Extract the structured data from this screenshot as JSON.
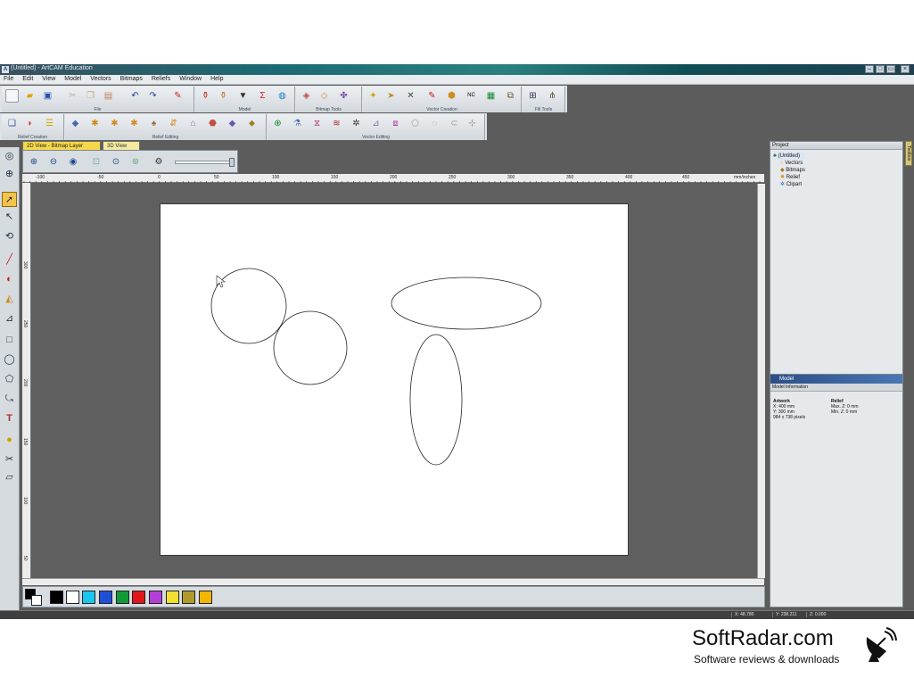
{
  "window": {
    "title": "(Untitled) - ArtCAM Education",
    "app_icon": "A"
  },
  "menu": [
    "File",
    "Edit",
    "View",
    "Model",
    "Vectors",
    "Bitmaps",
    "Reliefs",
    "Window",
    "Help"
  ],
  "toolbar_groups_row1": [
    "File",
    "Model",
    "Bitmap Tools",
    "Vector Creation",
    "Fill Tools"
  ],
  "toolbar_groups_row2": [
    "Relief Creation",
    "Relief Editing",
    "Vector Editing"
  ],
  "view_tabs": [
    {
      "label": "2D View - Bitmap Layer",
      "active": true
    },
    {
      "label": "3D View",
      "active": false
    }
  ],
  "ruler": {
    "h_labels": [
      "-100",
      "-50",
      "0",
      "50",
      "100",
      "150",
      "200",
      "250",
      "300",
      "350",
      "400",
      "450"
    ],
    "h_units": "mm/inches",
    "v_labels": [
      "300",
      "250",
      "200",
      "150",
      "100",
      "50",
      "0"
    ]
  },
  "project": {
    "header": "Project",
    "root": "(Untitled)",
    "items": [
      "Vectors",
      "Bitmaps",
      "Relief",
      "Clipart"
    ]
  },
  "model": {
    "header": "Model",
    "subheader": "Model Information",
    "artwork_title": "Artwork",
    "artwork_x": "X: 400 mm",
    "artwork_y": "Y: 300 mm",
    "artwork_pixels": "984 x 738 pixels",
    "relief_title": "Relief",
    "relief_max": "Max. Z: 0 mm",
    "relief_min": "Min. Z: 0 mm"
  },
  "side_tab": "Toolbox",
  "palette": {
    "colors": [
      "#000000",
      "#ffffff",
      "#19c6ee",
      "#1f4fd6",
      "#119a3a",
      "#e0161b",
      "#b43fd8",
      "#f0e030",
      "#b19a2c",
      "#f2b600"
    ]
  },
  "status": {
    "x": "X: 48.780",
    "y": "Y: 238.211",
    "z": "Z: 0.000"
  },
  "brand": {
    "name": "SoftRadar.com",
    "tagline": "Software reviews & downloads"
  }
}
